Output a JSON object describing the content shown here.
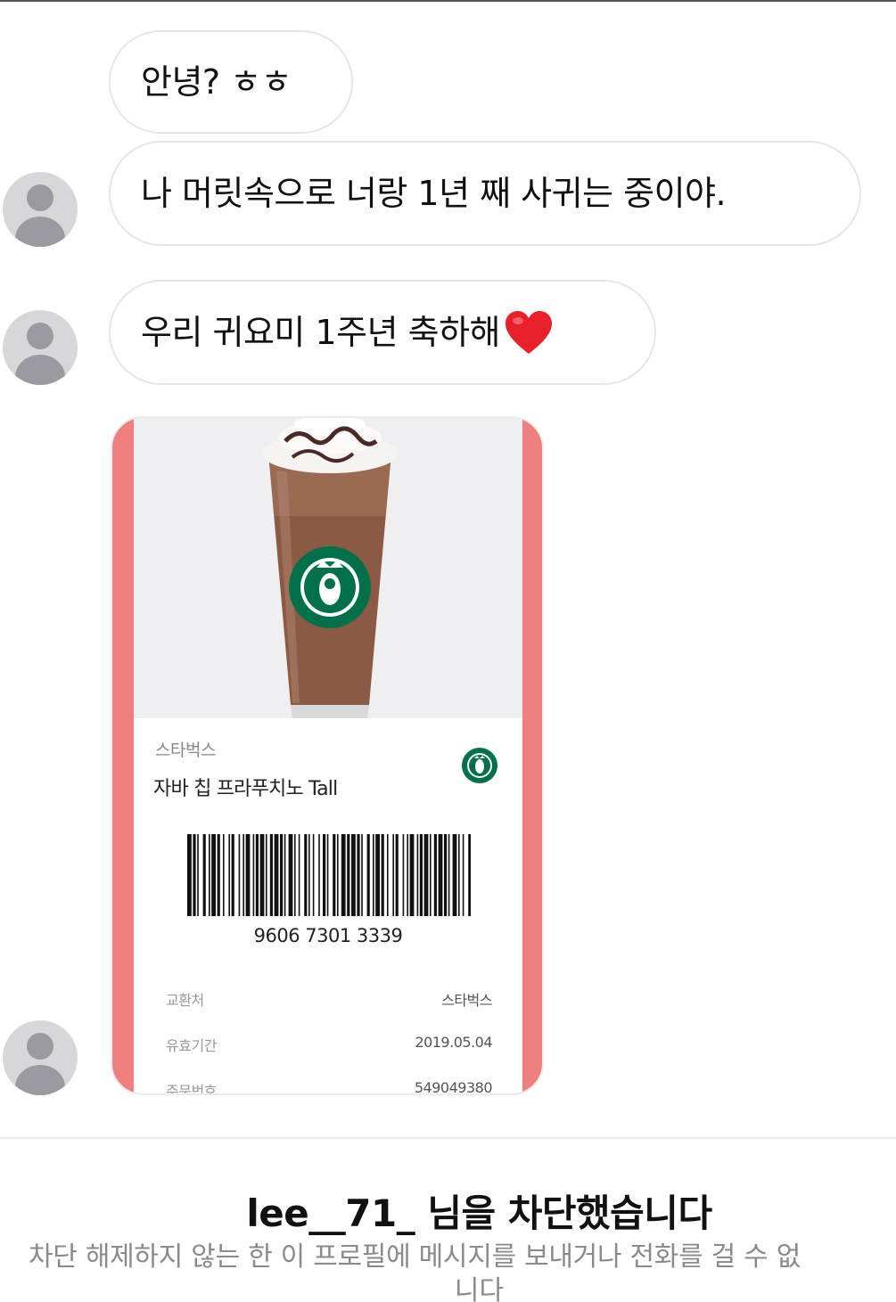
{
  "messages": [
    {
      "text": "안녕? ㅎㅎ",
      "emoji": ""
    },
    {
      "text": "나 머릿속으로 너랑 1년 째 사귀는 중이야.",
      "emoji": ""
    },
    {
      "text": "우리 귀요미 1주년 축하해",
      "emoji": "❤️"
    }
  ],
  "gift_card": {
    "brand": "스타벅스",
    "product": "자바 칩 프라푸치노 Tall",
    "barcode_number": "9606 7301 3339",
    "details": [
      {
        "label": "교환처",
        "value": "스타벅스"
      },
      {
        "label": "유효기간",
        "value": "2019.05.04"
      },
      {
        "label": "주문번호",
        "value": "549049380"
      }
    ],
    "accent_color": "#f07f7f"
  },
  "blocked": {
    "username": "lee__71_",
    "title_suffix": " 님을 차단했습니다",
    "description_line1": "차단 해제하지 않는 한 이 프로필에 메시지를 보내거나 전화를 걸 수 없",
    "description_line2": "니다"
  },
  "icons": {
    "avatar": "default-avatar-icon",
    "heart": "red-heart-emoji",
    "brand_logo": "starbucks-logo-icon"
  },
  "colors": {
    "bubble_border": "#e6e6e6",
    "avatar_bg": "#d7d7d9",
    "avatar_fg": "#9a9aa0",
    "heart": "#e8202a",
    "starbucks_green": "#00704a"
  }
}
